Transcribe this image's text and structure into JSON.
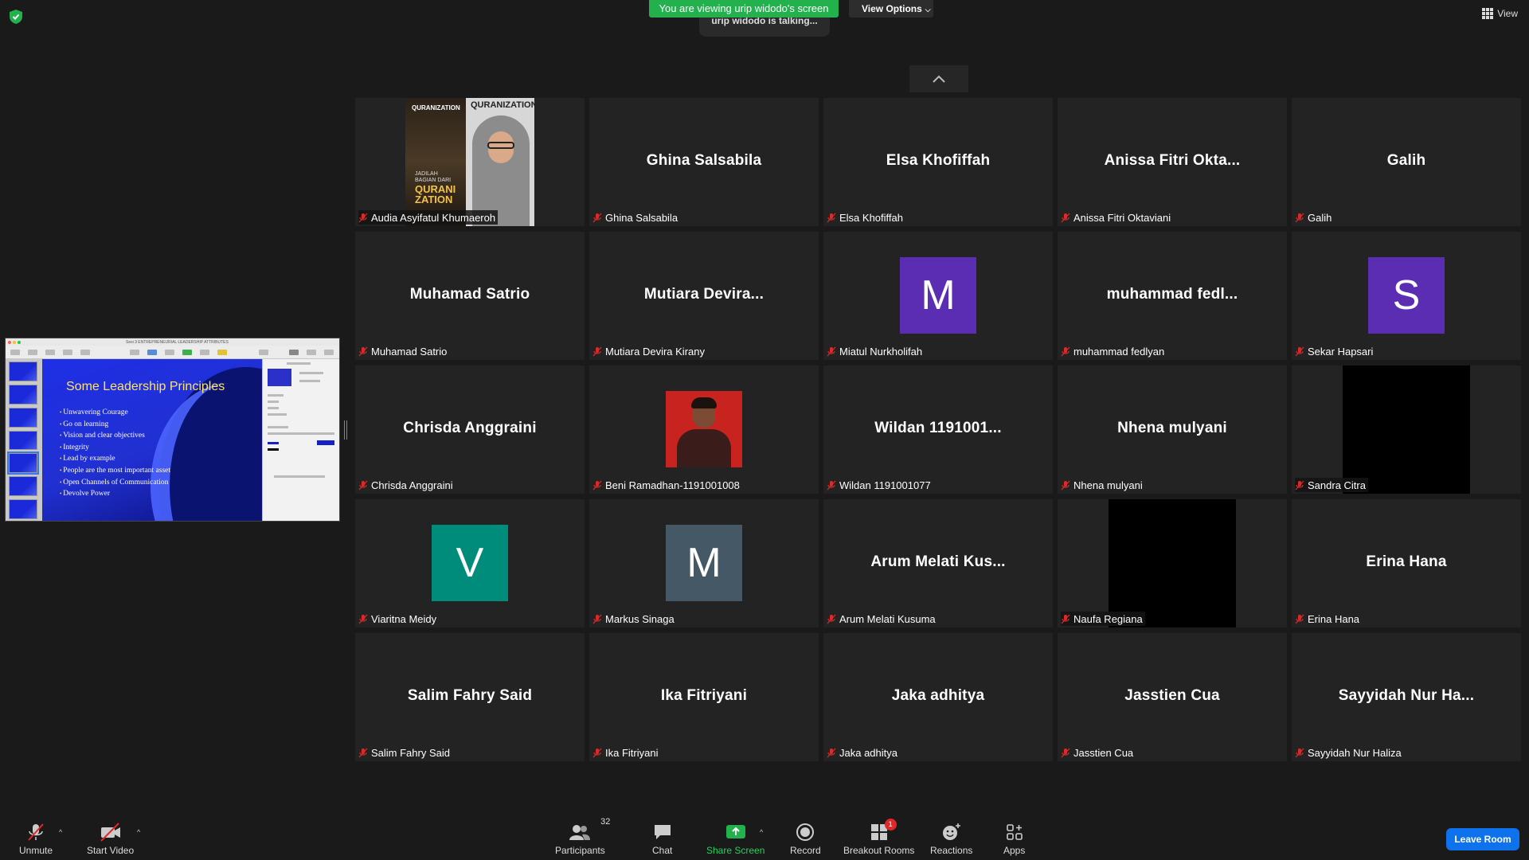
{
  "top": {
    "share_banner": "You are viewing urip widodo's screen",
    "view_options": "View Options",
    "talking": "urip widodo is talking...",
    "view_button": "View"
  },
  "shared_slide": {
    "window_title": "Sesi 3 ENTREPRENEURIAL LEADERSHIP ATTRIBUTES",
    "slide_title": "Some Leadership Principles",
    "bullets": [
      "Unwavering Courage",
      "Go on learning",
      "Vision and clear objectives",
      "Integrity",
      "Lead by example",
      "People are the most important asset",
      "Open Channels of Communication",
      "Devolve Power"
    ]
  },
  "tiles": [
    {
      "name": "Audia Asyifatul Khumaeroh",
      "display": "",
      "type": "photo-quran"
    },
    {
      "name": "Ghina Salsabila",
      "display": "Ghina Salsabila",
      "type": "name"
    },
    {
      "name": "Elsa Khofiffah",
      "display": "Elsa Khofiffah",
      "type": "name"
    },
    {
      "name": "Anissa Fitri Oktaviani",
      "display": "Anissa Fitri Okta...",
      "type": "name"
    },
    {
      "name": "Galih",
      "display": "Galih",
      "type": "name"
    },
    {
      "name": "Muhamad Satrio",
      "display": "Muhamad Satrio",
      "type": "name"
    },
    {
      "name": "Mutiara Devira Kirany",
      "display": "Mutiara Devira...",
      "type": "name"
    },
    {
      "name": "Miatul Nurkholifah",
      "display": "M",
      "type": "avatar",
      "color": "#5a2db3"
    },
    {
      "name": "muhammad fedlyan",
      "display": "muhammad fedl...",
      "type": "name"
    },
    {
      "name": "Sekar Hapsari",
      "display": "S",
      "type": "avatar",
      "color": "#5a2db3"
    },
    {
      "name": "Chrisda Anggraini",
      "display": "Chrisda Anggraini",
      "type": "name"
    },
    {
      "name": "Beni Ramadhan-1191001008",
      "display": "",
      "type": "photo-beni"
    },
    {
      "name": "Wildan 1191001077",
      "display": "Wildan 1191001...",
      "type": "name"
    },
    {
      "name": "Nhena mulyani",
      "display": "Nhena mulyani",
      "type": "name"
    },
    {
      "name": "Sandra Citra",
      "display": "",
      "type": "black"
    },
    {
      "name": "Viaritna Meidy",
      "display": "V",
      "type": "avatar",
      "color": "#008c7a"
    },
    {
      "name": "Markus Sinaga",
      "display": "M",
      "type": "avatar",
      "color": "#445866"
    },
    {
      "name": "Arum Melati Kusuma",
      "display": "Arum Melati Kus...",
      "type": "name"
    },
    {
      "name": "Naufa Regiana",
      "display": "",
      "type": "black"
    },
    {
      "name": "Erina Hana",
      "display": "Erina Hana",
      "type": "name"
    },
    {
      "name": "Salim Fahry Said",
      "display": "Salim Fahry Said",
      "type": "name"
    },
    {
      "name": "Ika Fitriyani",
      "display": "Ika Fitriyani",
      "type": "name"
    },
    {
      "name": "Jaka adhitya",
      "display": "Jaka adhitya",
      "type": "name"
    },
    {
      "name": "Jasstien Cua",
      "display": "Jasstien Cua",
      "type": "name"
    },
    {
      "name": "Sayyidah Nur Haliza",
      "display": "Sayyidah Nur Ha...",
      "type": "name"
    }
  ],
  "bottom": {
    "unmute": "Unmute",
    "start_video": "Start Video",
    "participants": "Participants",
    "participants_count": "32",
    "chat": "Chat",
    "share_screen": "Share Screen",
    "record": "Record",
    "breakout_rooms": "Breakout Rooms",
    "breakout_badge": "1",
    "reactions": "Reactions",
    "apps": "Apps",
    "leave_room": "Leave Room"
  },
  "colors": {
    "share_green": "#23b14d",
    "leave_blue": "#0e72ed",
    "mute_red": "#e02828"
  }
}
